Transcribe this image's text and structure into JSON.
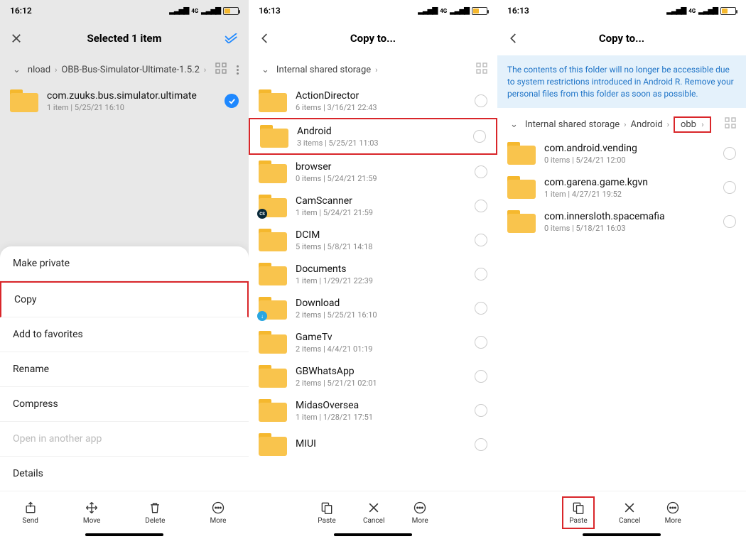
{
  "panel1": {
    "time": "16:12",
    "header_title": "Selected 1 item",
    "breadcrumb": {
      "pre": "nload",
      "mid": "OBB-Bus-Simulator-Ultimate-1.5.2"
    },
    "item": {
      "name": "com.zuuks.bus.simulator.ultimate",
      "count": "1 item",
      "date": "5/25/21 16:10"
    },
    "sheet": {
      "make_private": "Make private",
      "copy": "Copy",
      "add_fav": "Add to favorites",
      "rename": "Rename",
      "compress": "Compress",
      "open_other": "Open in another app",
      "details": "Details"
    },
    "bottom": {
      "send": "Send",
      "move": "Move",
      "delete": "Delete",
      "more": "More"
    }
  },
  "panel2": {
    "time": "16:13",
    "header_title": "Copy to...",
    "breadcrumb": {
      "root": "Internal shared storage"
    },
    "folders": [
      {
        "name": "ActionDirector",
        "count": "6 items",
        "date": "3/16/21 22:43"
      },
      {
        "name": "Android",
        "count": "3 items",
        "date": "5/25/21 11:03",
        "highlight": true
      },
      {
        "name": "browser",
        "count": "0 items",
        "date": "5/24/21 21:59"
      },
      {
        "name": "CamScanner",
        "count": "1 item",
        "date": "5/24/21 21:59",
        "badge": "cs"
      },
      {
        "name": "DCIM",
        "count": "5 items",
        "date": "5/8/21 14:18"
      },
      {
        "name": "Documents",
        "count": "1 item",
        "date": "1/29/21 22:39"
      },
      {
        "name": "Download",
        "count": "2 items",
        "date": "5/25/21 16:10",
        "badge": "dl"
      },
      {
        "name": "GameTv",
        "count": "2 items",
        "date": "4/4/21 01:19"
      },
      {
        "name": "GBWhatsApp",
        "count": "2 items",
        "date": "5/21/21 02:01"
      },
      {
        "name": "MidasOversea",
        "count": "1 item",
        "date": "1/28/21 17:51"
      },
      {
        "name": "MIUI",
        "count": "",
        "date": ""
      }
    ],
    "bottom": {
      "paste": "Paste",
      "cancel": "Cancel",
      "more": "More"
    }
  },
  "panel3": {
    "time": "16:13",
    "header_title": "Copy to...",
    "info": "The contents of this folder will no longer be accessible due to system restrictions introduced in Android R. Remove your personal files from this folder as soon as possible.",
    "breadcrumb": {
      "root": "Internal shared storage",
      "seg1": "Android",
      "seg2": "obb"
    },
    "folders": [
      {
        "name": "com.android.vending",
        "count": "0 items",
        "date": "5/24/21 12:00"
      },
      {
        "name": "com.garena.game.kgvn",
        "count": "1 item",
        "date": "4/27/21 19:52"
      },
      {
        "name": "com.innersloth.spacemafia",
        "count": "0 items",
        "date": "5/18/21 16:03"
      }
    ],
    "bottom": {
      "paste": "Paste",
      "cancel": "Cancel",
      "more": "More"
    }
  }
}
